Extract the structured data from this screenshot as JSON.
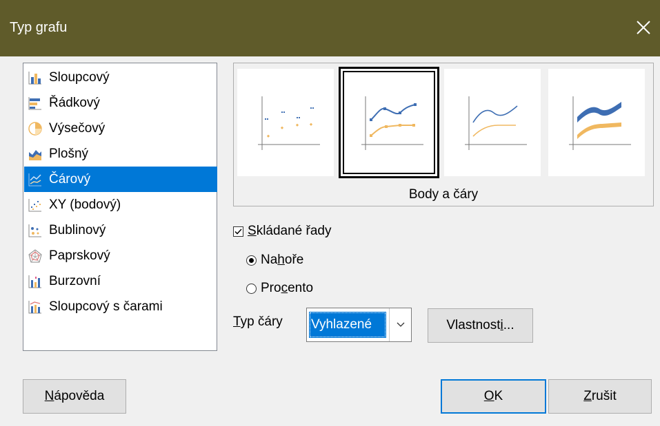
{
  "window": {
    "title": "Typ grafu"
  },
  "chart_types": [
    {
      "label": "Sloupcový",
      "icon": "column-chart-icon",
      "selected": false
    },
    {
      "label": "Řádkový",
      "icon": "bar-chart-icon",
      "selected": false
    },
    {
      "label": "Výsečový",
      "icon": "pie-chart-icon",
      "selected": false
    },
    {
      "label": "Plošný",
      "icon": "area-chart-icon",
      "selected": false
    },
    {
      "label": "Čárový",
      "icon": "line-chart-icon",
      "selected": true
    },
    {
      "label": "XY (bodový)",
      "icon": "xy-scatter-icon",
      "selected": false
    },
    {
      "label": "Bublinový",
      "icon": "bubble-chart-icon",
      "selected": false
    },
    {
      "label": "Paprskový",
      "icon": "net-chart-icon",
      "selected": false
    },
    {
      "label": "Burzovní",
      "icon": "stock-chart-icon",
      "selected": false
    },
    {
      "label": "Sloupcový s čarami",
      "icon": "column-and-line-icon",
      "selected": false
    }
  ],
  "variants": [
    {
      "name": "points-only-variant",
      "selected": false
    },
    {
      "name": "points-and-lines-variant",
      "selected": true
    },
    {
      "name": "lines-only-variant",
      "selected": false
    },
    {
      "name": "3d-lines-variant",
      "selected": false
    }
  ],
  "variant_label": "Body a čáry",
  "stacked": {
    "label_u": "S",
    "label_rest": "kládané řady",
    "checked": true
  },
  "stack_options": [
    {
      "label_pre": "Na",
      "label_u": "h",
      "label_post": "oře",
      "selected": true
    },
    {
      "label_pre": "Pro",
      "label_u": "c",
      "label_post": "ento",
      "selected": false
    }
  ],
  "line_type": {
    "label_u": "T",
    "label_rest": "yp čáry",
    "value": "Vyhlazené"
  },
  "buttons": {
    "properties": {
      "pre": "Vlastnost",
      "u": "i",
      "post": "..."
    },
    "help": {
      "u": "N",
      "post": "ápověda"
    },
    "ok": {
      "u": "O",
      "post": "K"
    },
    "cancel": {
      "u": "Z",
      "post": "rušit"
    }
  },
  "colors": {
    "titlebar": "#5f5b2a",
    "selection": "#0078d7",
    "series_blue": "#3e6eb3",
    "series_orange": "#f0b860"
  }
}
